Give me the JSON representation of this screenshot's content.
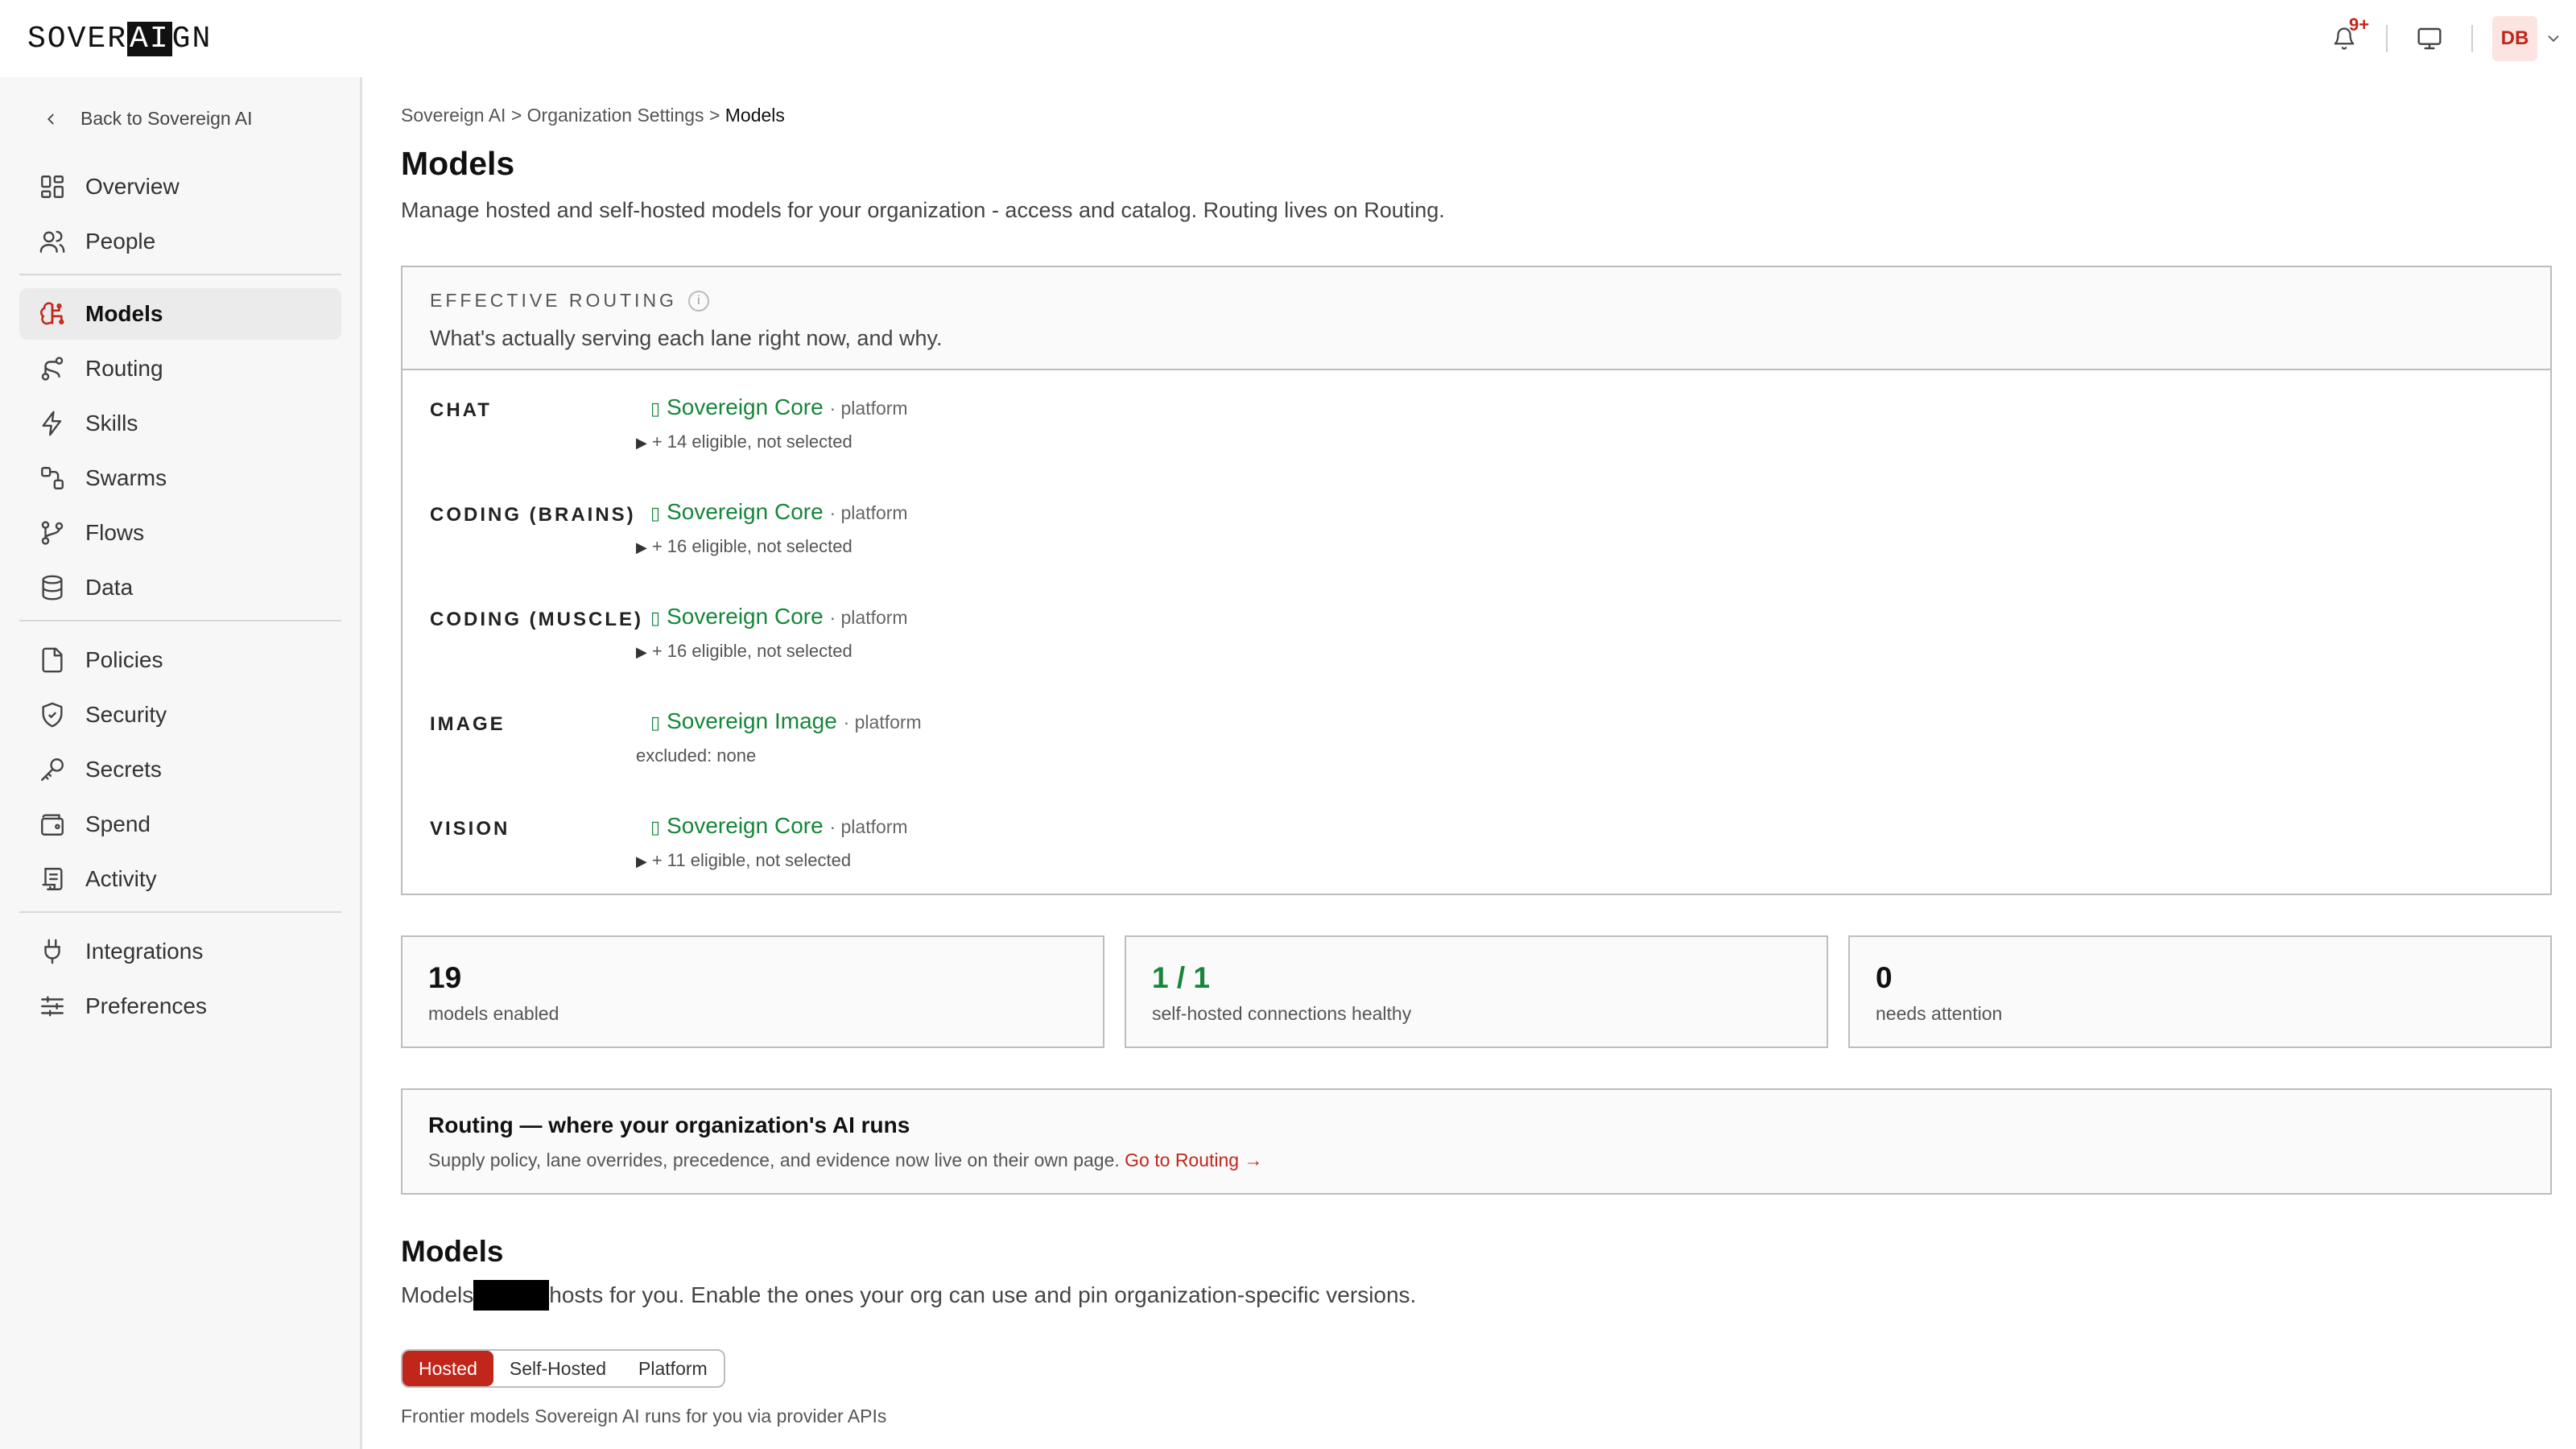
{
  "brand": {
    "logo_prefix": "SOVER",
    "logo_ai": "AI",
    "logo_suffix": "GN"
  },
  "topbar": {
    "notification_badge": "9+",
    "avatar_initials": "DB"
  },
  "sidebar": {
    "back_label": "Back to Sovereign AI",
    "group1": [
      {
        "label": "Overview",
        "icon": "grid-icon"
      },
      {
        "label": "People",
        "icon": "people-icon"
      }
    ],
    "group2": [
      {
        "label": "Models",
        "icon": "brain-icon",
        "active": true
      },
      {
        "label": "Routing",
        "icon": "route-icon"
      },
      {
        "label": "Skills",
        "icon": "lightning-icon"
      },
      {
        "label": "Swarms",
        "icon": "swarm-icon"
      },
      {
        "label": "Flows",
        "icon": "branch-icon"
      },
      {
        "label": "Data",
        "icon": "database-icon"
      }
    ],
    "group3": [
      {
        "label": "Policies",
        "icon": "document-icon"
      },
      {
        "label": "Security",
        "icon": "shield-icon"
      },
      {
        "label": "Secrets",
        "icon": "key-icon"
      },
      {
        "label": "Spend",
        "icon": "wallet-icon"
      },
      {
        "label": "Activity",
        "icon": "scroll-icon"
      }
    ],
    "group4": [
      {
        "label": "Integrations",
        "icon": "plug-icon"
      },
      {
        "label": "Preferences",
        "icon": "sliders-icon"
      }
    ]
  },
  "breadcrumb": {
    "root": "Sovereign AI",
    "sep": ">",
    "parent": "Organization Settings",
    "current": "Models"
  },
  "page": {
    "title": "Models",
    "subtitle": "Manage hosted and self-hosted models for your organization - access and catalog. Routing lives on Routing."
  },
  "effective_routing": {
    "kicker": "EFFECTIVE ROUTING",
    "info_glyph": "i",
    "description": "What's actually serving each lane right now, and why.",
    "lanes": [
      {
        "name": "CHAT",
        "model": "Sovereign Core",
        "tag": "· platform",
        "sub": "+ 14 eligible, not selected",
        "expandable": true
      },
      {
        "name": "CODING (BRAINS)",
        "model": "Sovereign Core",
        "tag": "· platform",
        "sub": "+ 16 eligible, not selected",
        "expandable": true
      },
      {
        "name": "CODING (MUSCLE)",
        "model": "Sovereign Core",
        "tag": "· platform",
        "sub": "+ 16 eligible, not selected",
        "expandable": true
      },
      {
        "name": "IMAGE",
        "model": "Sovereign Image",
        "tag": "· platform",
        "sub": "excluded: none",
        "expandable": false
      },
      {
        "name": "VISION",
        "model": "Sovereign Core",
        "tag": "· platform",
        "sub": "+ 11 eligible, not selected",
        "expandable": true
      }
    ]
  },
  "stats": [
    {
      "value": "19",
      "label": "models enabled",
      "color": "#111111"
    },
    {
      "value": "1 / 1",
      "label": "self-hosted connections healthy",
      "color": "#16863a"
    },
    {
      "value": "0",
      "label": "needs attention",
      "color": "#111111"
    }
  ],
  "routing_callout": {
    "title": "Routing — where your organization's AI runs",
    "text": "Supply policy, lane overrides, precedence, and evidence now live on their own page.",
    "link": "Go to Routing →"
  },
  "models_section": {
    "title": "Models",
    "sub_before": "Models",
    "sub_after": "hosts for you. Enable the ones your org can use and pin organization-specific versions.",
    "tabs": [
      "Hosted",
      "Self-Hosted",
      "Platform"
    ],
    "active_tab": "Hosted",
    "hosted_description": "Frontier models Sovereign AI runs for you via provider APIs"
  },
  "colors": {
    "accent": "#c0271a",
    "success": "#16863a"
  }
}
